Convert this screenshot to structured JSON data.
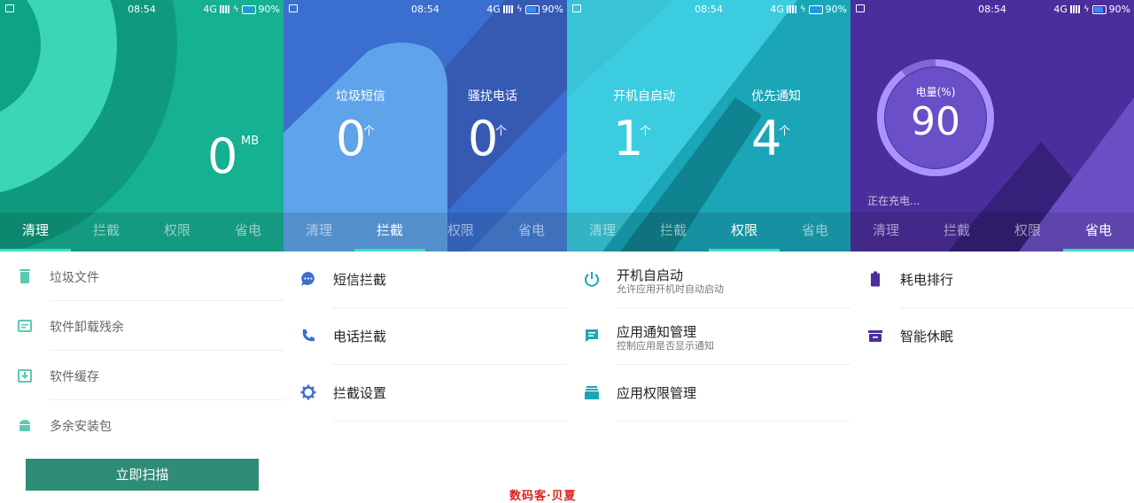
{
  "status_bar": {
    "time": "08:54",
    "network": "4G",
    "battery": "90%"
  },
  "tabs": [
    "清理",
    "拦截",
    "权限",
    "省电"
  ],
  "screens": [
    {
      "active_tab": 0,
      "hero": {
        "value": "0",
        "unit": "MB"
      },
      "items": [
        {
          "label": "垃圾文件",
          "icon": "trash-icon"
        },
        {
          "label": "软件卸载残余",
          "icon": "uninstall-residue-icon"
        },
        {
          "label": "软件缓存",
          "icon": "cache-download-icon"
        },
        {
          "label": "多余安装包",
          "icon": "android-package-icon"
        }
      ],
      "button": "立即扫描",
      "accent": "#2f8c76"
    },
    {
      "active_tab": 1,
      "stats": [
        {
          "label": "垃圾短信",
          "value": "0",
          "unit": "个"
        },
        {
          "label": "骚扰电话",
          "value": "0",
          "unit": "个"
        }
      ],
      "items": [
        {
          "label": "短信拦截",
          "icon": "sms-bubble-icon"
        },
        {
          "label": "电话拦截",
          "icon": "phone-icon"
        },
        {
          "label": "拦截设置",
          "icon": "gear-icon"
        }
      ],
      "accent": "#3a6fd0"
    },
    {
      "active_tab": 2,
      "stats": [
        {
          "label": "开机自启动",
          "value": "1",
          "unit": "个"
        },
        {
          "label": "优先通知",
          "value": "4",
          "unit": "个"
        }
      ],
      "items": [
        {
          "label": "开机自启动",
          "sub": "允许应用开机时自动启动",
          "icon": "power-icon"
        },
        {
          "label": "应用通知管理",
          "sub": "控制应用是否显示通知",
          "icon": "notification-message-icon"
        },
        {
          "label": "应用权限管理",
          "icon": "permission-stack-icon"
        }
      ],
      "accent": "#1ba6b8"
    },
    {
      "active_tab": 3,
      "gauge": {
        "label": "电量(%)",
        "value": "90",
        "level": 0.9
      },
      "charging_text": "正在充电...",
      "items": [
        {
          "label": "耗电排行",
          "icon": "battery-icon"
        },
        {
          "label": "智能休眠",
          "icon": "sleep-box-icon"
        }
      ],
      "accent": "#4b2e9c"
    }
  ],
  "watermark": "数码客·贝夏"
}
